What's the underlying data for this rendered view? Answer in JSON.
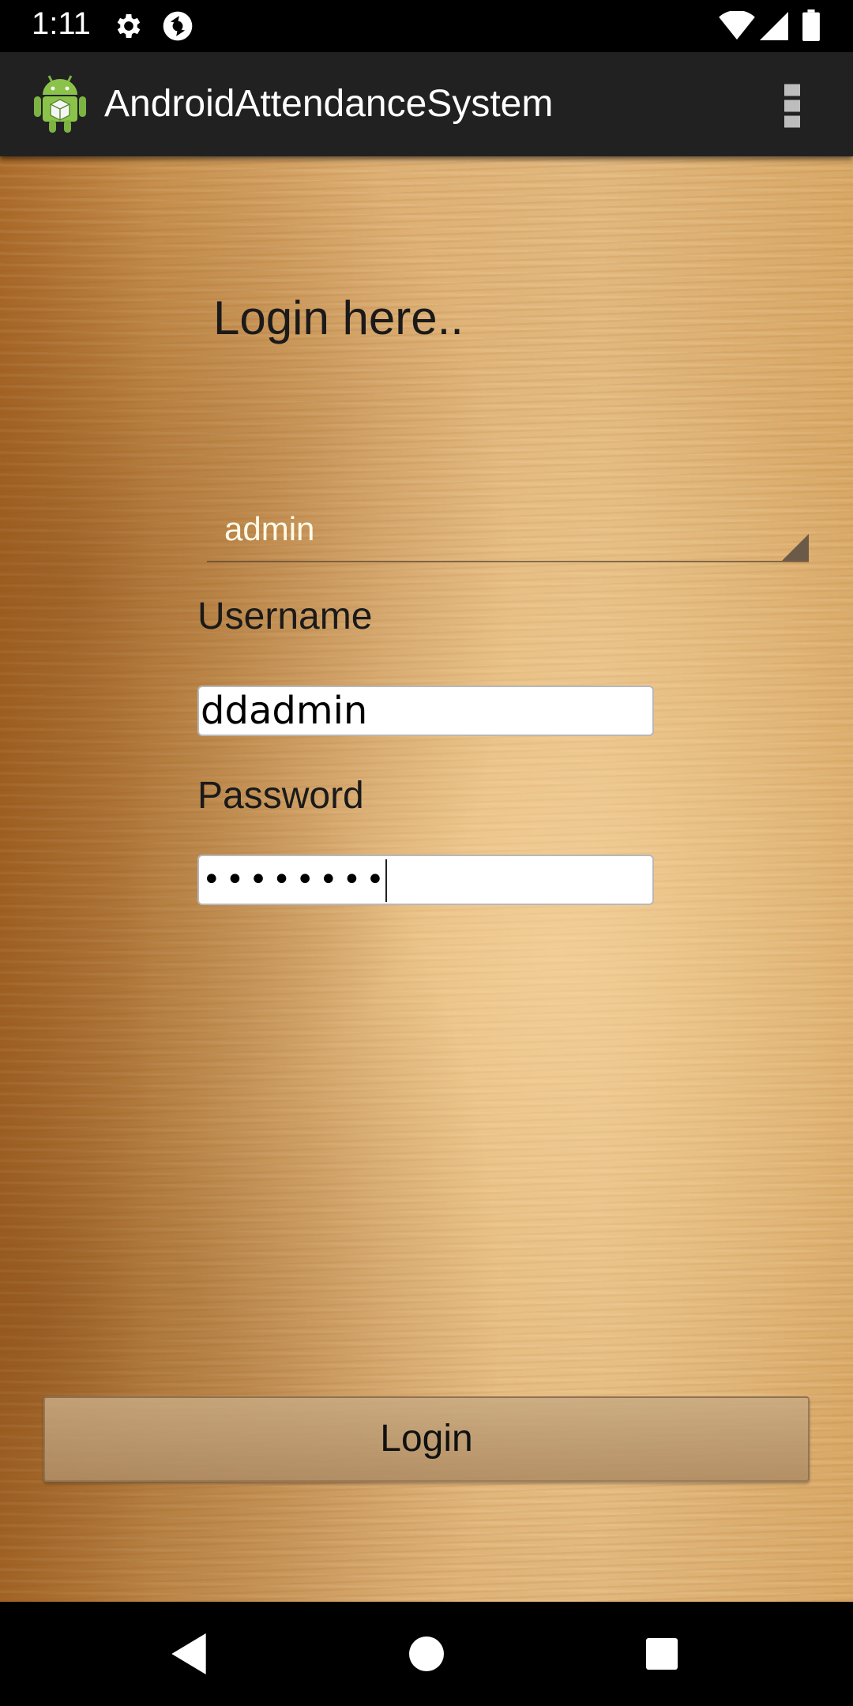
{
  "status_bar": {
    "time": "1:11",
    "icons": [
      "gear-icon",
      "sync-icon",
      "wifi-icon",
      "cell-signal-icon",
      "battery-icon"
    ]
  },
  "action_bar": {
    "title": "AndroidAttendanceSystem",
    "app_icon": "android-app-icon",
    "menu_icon": "overflow-menu-icon"
  },
  "login": {
    "heading": "Login here..",
    "role_spinner": {
      "selected": "admin"
    },
    "username_label": "Username",
    "username_value": "ddadmin",
    "password_label": "Password",
    "password_mask": "••••••••",
    "button_label": "Login"
  },
  "nav_bar": {
    "icons": [
      "back-icon",
      "home-icon",
      "recent-apps-icon"
    ]
  },
  "colors": {
    "status_bar_bg": "#000000",
    "action_bar_bg": "#212121",
    "wood_background": "#d8a866",
    "spinner_text": "#fffbe8"
  }
}
